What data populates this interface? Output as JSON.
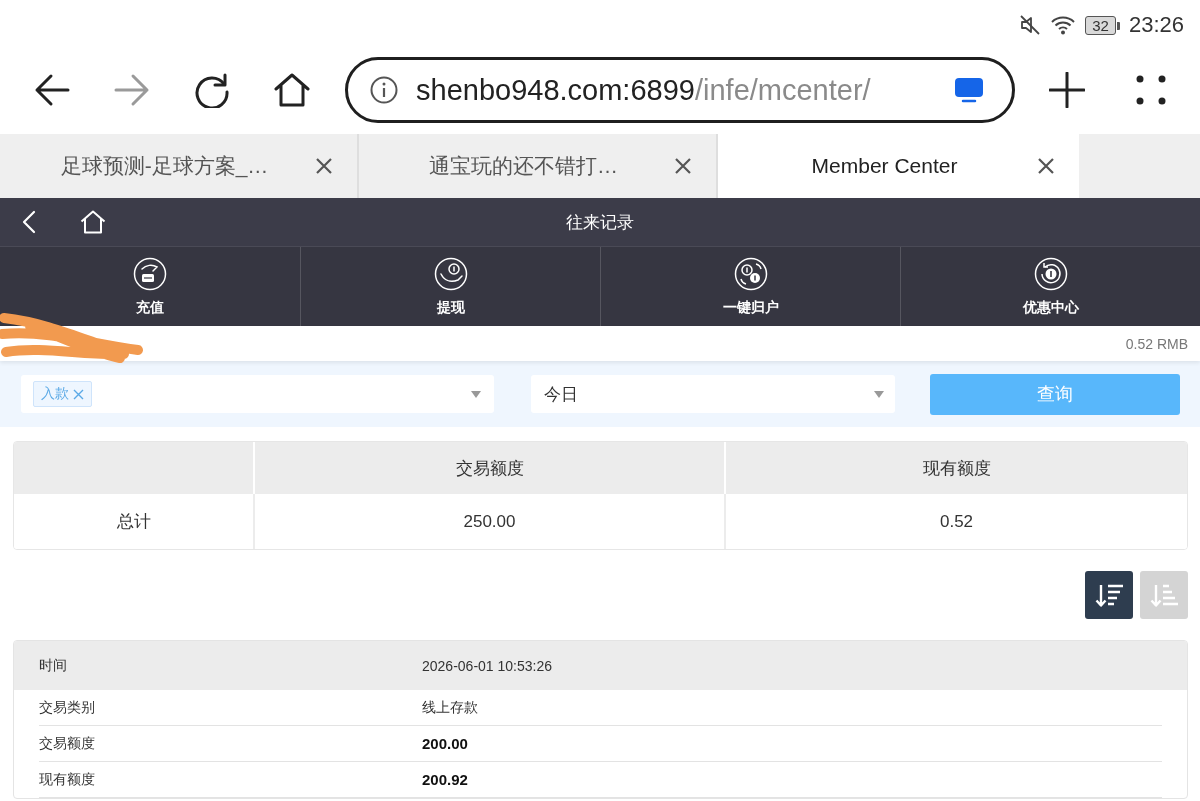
{
  "status_bar": {
    "battery": "32",
    "time": "23:26"
  },
  "browser": {
    "url_host": "shenbo948.com:6899",
    "url_path": "/infe/mcenter/",
    "tabs": [
      {
        "title": "足球预测-足球方案_…",
        "selected": false
      },
      {
        "title": "通宝玩的还不错打…",
        "selected": false
      },
      {
        "title": "Member Center",
        "selected": true
      }
    ]
  },
  "page": {
    "title": "往来记录",
    "menu": [
      {
        "label": "充值",
        "kind": "recharge"
      },
      {
        "label": "提现",
        "kind": "withdraw"
      },
      {
        "label": "一键归户",
        "kind": "consolidate"
      },
      {
        "label": "优惠中心",
        "kind": "promo"
      }
    ]
  },
  "account": {
    "balance": "0.52 RMB"
  },
  "filter": {
    "tags": [
      "入款"
    ],
    "period": "今日",
    "button": "查询"
  },
  "summary": {
    "columns": [
      "交易额度",
      "现有额度"
    ],
    "rows": [
      {
        "label": "总计",
        "cells": [
          "250.00",
          "0.52"
        ]
      }
    ]
  },
  "sort_buttons": [
    {
      "kind": "descending",
      "selected": true
    },
    {
      "kind": "ascending",
      "selected": false
    }
  ],
  "record": {
    "header": {
      "label": "时间",
      "value": "2026-06-01 10:53:26"
    },
    "fields": [
      {
        "label": "交易类别",
        "value": "线上存款",
        "bold": false
      },
      {
        "label": "交易额度",
        "value": "200.00",
        "bold": true
      },
      {
        "label": "现有额度",
        "value": "200.92",
        "bold": true
      }
    ]
  }
}
